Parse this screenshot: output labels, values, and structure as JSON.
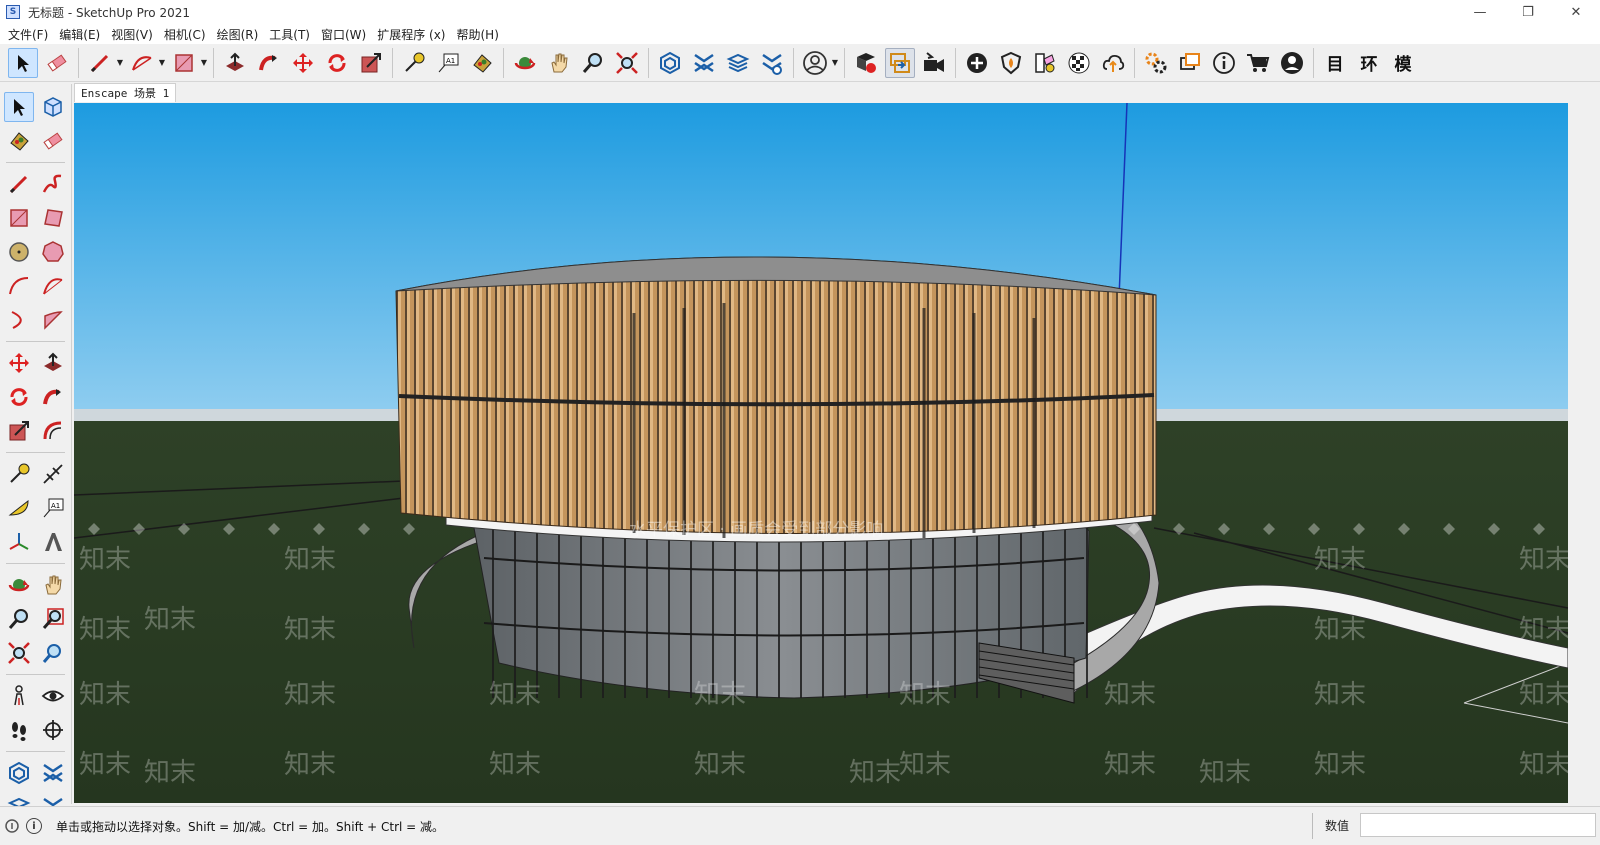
{
  "window": {
    "title": "无标题 - SketchUp Pro 2021",
    "minimize": "—",
    "restore": "❐",
    "close": "✕"
  },
  "menu": [
    "文件(F)",
    "编辑(E)",
    "视图(V)",
    "相机(C)",
    "绘图(R)",
    "工具(T)",
    "窗口(W)",
    "扩展程序 (x)",
    "帮助(H)"
  ],
  "toolbar": {
    "text_buttons": [
      "目",
      "环",
      "模"
    ]
  },
  "scene_tab": "Enscape 场景 1",
  "viewport": {
    "overlay_caption": "水平保护区 · 画质会受到部分影响",
    "watermark": "知末"
  },
  "status": {
    "text": "单击或拖动以选择对象。Shift = 加/减。Ctrl = 加。Shift + Ctrl = 减。",
    "measurements_label": "数值",
    "measurements_value": ""
  },
  "colors": {
    "sky_top": "#1d9be0",
    "sky_bottom": "#8fcdf0",
    "ground": "#283a22",
    "wood": "#c99a62",
    "glass": "#7a7e82",
    "accent": "#cfe6ff"
  }
}
